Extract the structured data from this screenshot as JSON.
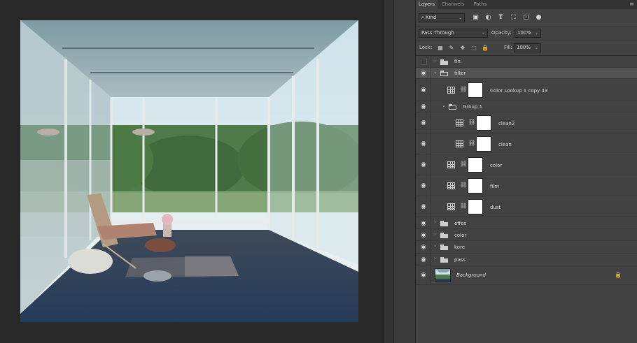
{
  "panel": {
    "tabs": [
      "Layers",
      "Channels",
      "Paths"
    ],
    "menu_icon": "panel-menu-icon",
    "filter_kind": "Kind",
    "blend_mode": "Pass Through",
    "opacity_label": "Opacity:",
    "opacity_value": "100%",
    "lock_label": "Lock:",
    "fill_label": "Fill:",
    "fill_value": "100%"
  },
  "layers": [
    {
      "name": "fin",
      "type": "group",
      "visible": false,
      "expanded": false
    },
    {
      "name": "filter",
      "type": "group",
      "visible": true,
      "expanded": true,
      "selected": true
    },
    {
      "name": "Color Lookup 1 copy 43",
      "type": "adjustment",
      "visible": true
    },
    {
      "name": "Group 1",
      "type": "group",
      "visible": true,
      "expanded": true
    },
    {
      "name": "clean2",
      "type": "adjustment",
      "visible": true
    },
    {
      "name": "clean",
      "type": "adjustment",
      "visible": true
    },
    {
      "name": "color",
      "type": "adjustment",
      "visible": true
    },
    {
      "name": "film",
      "type": "adjustment",
      "visible": true
    },
    {
      "name": "dust",
      "type": "adjustment",
      "visible": true
    },
    {
      "name": "effes",
      "type": "group",
      "visible": true,
      "expanded": false
    },
    {
      "name": "color",
      "type": "group",
      "visible": true,
      "expanded": false
    },
    {
      "name": "kore",
      "type": "group",
      "visible": true,
      "expanded": false
    },
    {
      "name": "pass",
      "type": "group",
      "visible": true,
      "expanded": false
    },
    {
      "name": "Background",
      "type": "background",
      "visible": true,
      "locked": true
    }
  ],
  "colors": {
    "panel_bg": "#424242",
    "selected_row": "#535353",
    "canvas_bg": "#282828"
  }
}
